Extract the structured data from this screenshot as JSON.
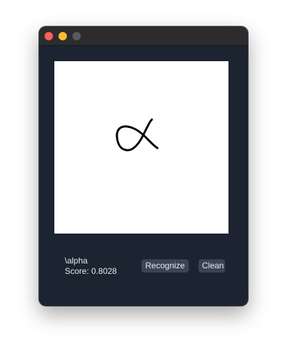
{
  "window": {
    "traffic_lights": [
      "close",
      "minimize",
      "zoom"
    ]
  },
  "canvas": {
    "background": "#ffffff",
    "stroke_color": "#000000",
    "drawing": "handwritten alpha symbol"
  },
  "result": {
    "label": "\\alpha",
    "score_text": "Score: 0.8028"
  },
  "buttons": {
    "recognize_label": "Recognize",
    "clean_label": "Clean"
  },
  "colors": {
    "window_bg": "#1b2430",
    "titlebar_bg": "#2c2c2e",
    "button_bg": "#3a4554",
    "text": "#e6e9ee"
  }
}
